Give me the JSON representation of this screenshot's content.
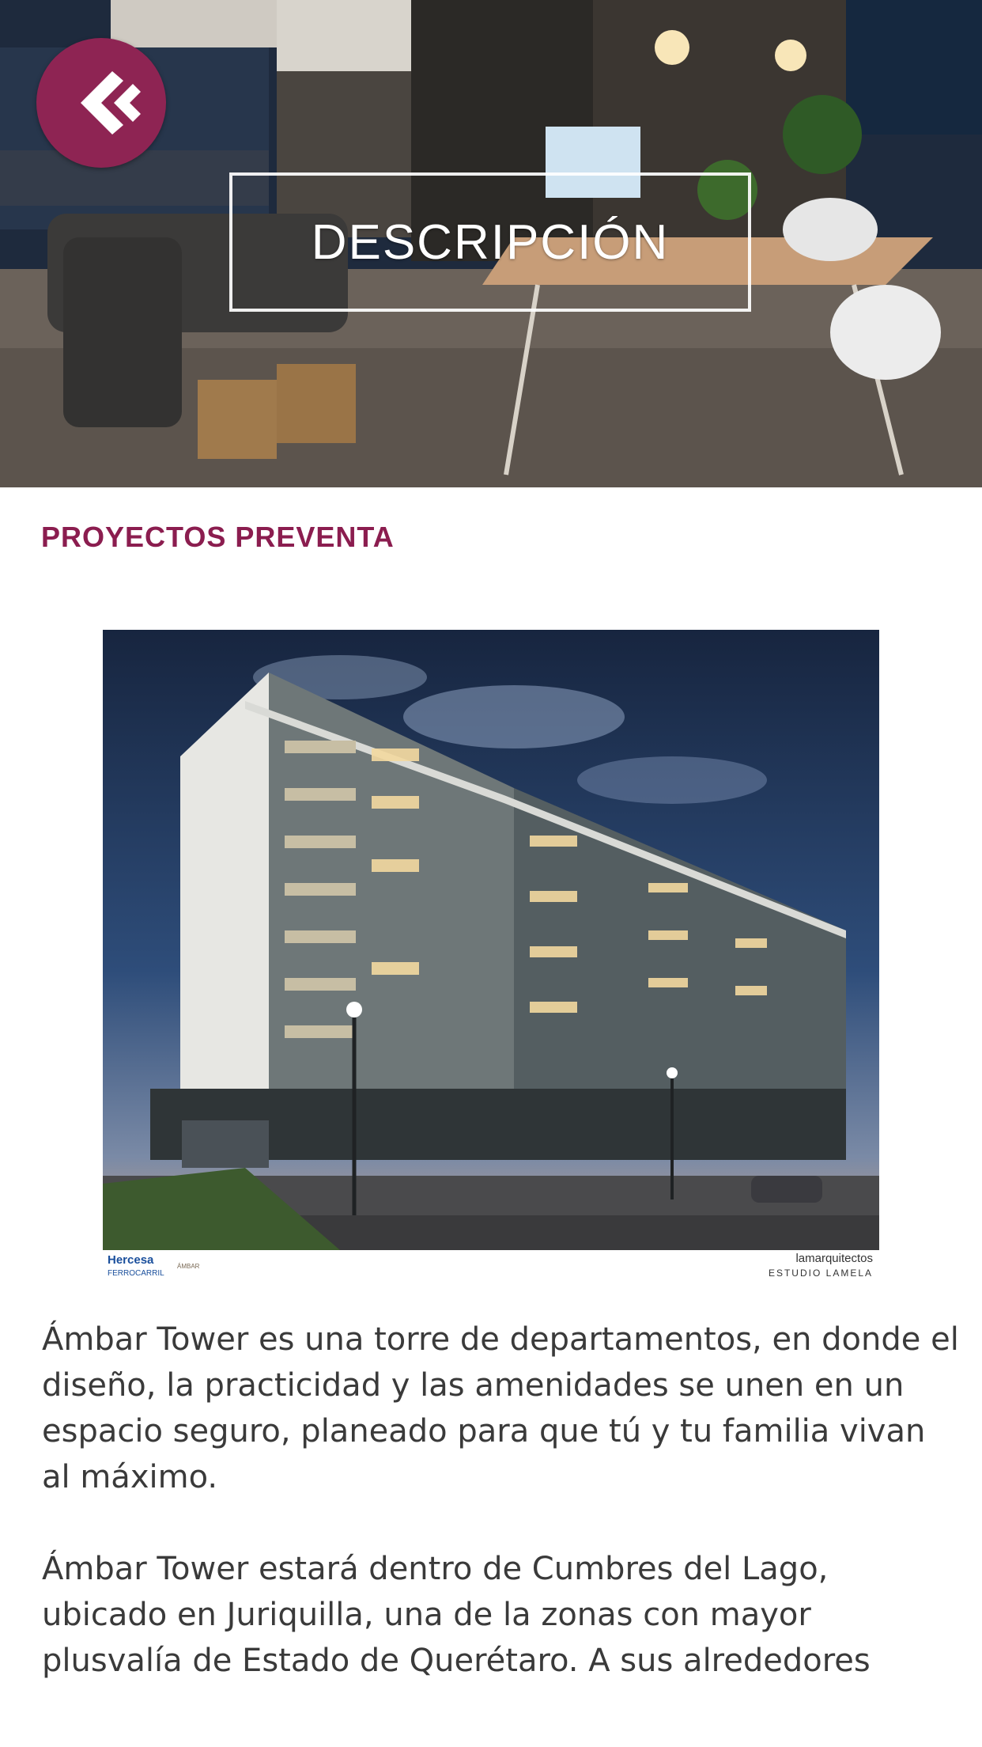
{
  "hero": {
    "title": "DESCRIPCIÓN",
    "back_icon": "double-chevron-left-icon",
    "accent_color": "#8e2453"
  },
  "section": {
    "heading": "PROYECTOS PREVENTA",
    "heading_color": "#8b1d4f"
  },
  "project_image": {
    "logos": {
      "left_brand": "Hercesa",
      "left_sub": "FERROCARRIL",
      "left_mark": "ÁMBAR",
      "right_brand": "lamarquitectos",
      "right_sub": "ESTUDIO LAMELA"
    }
  },
  "description": {
    "paragraphs": [
      "Ámbar Tower es una torre de departamentos, en donde el diseño, la practicidad y las amenidades se unen en un espacio seguro, planeado para que tú y tu familia vivan al máximo.",
      "Ámbar Tower estará dentro de Cumbres del Lago, ubicado en Juriquilla, una de la zonas con mayor plusvalía de Estado de Querétaro. A sus alrededores"
    ]
  }
}
